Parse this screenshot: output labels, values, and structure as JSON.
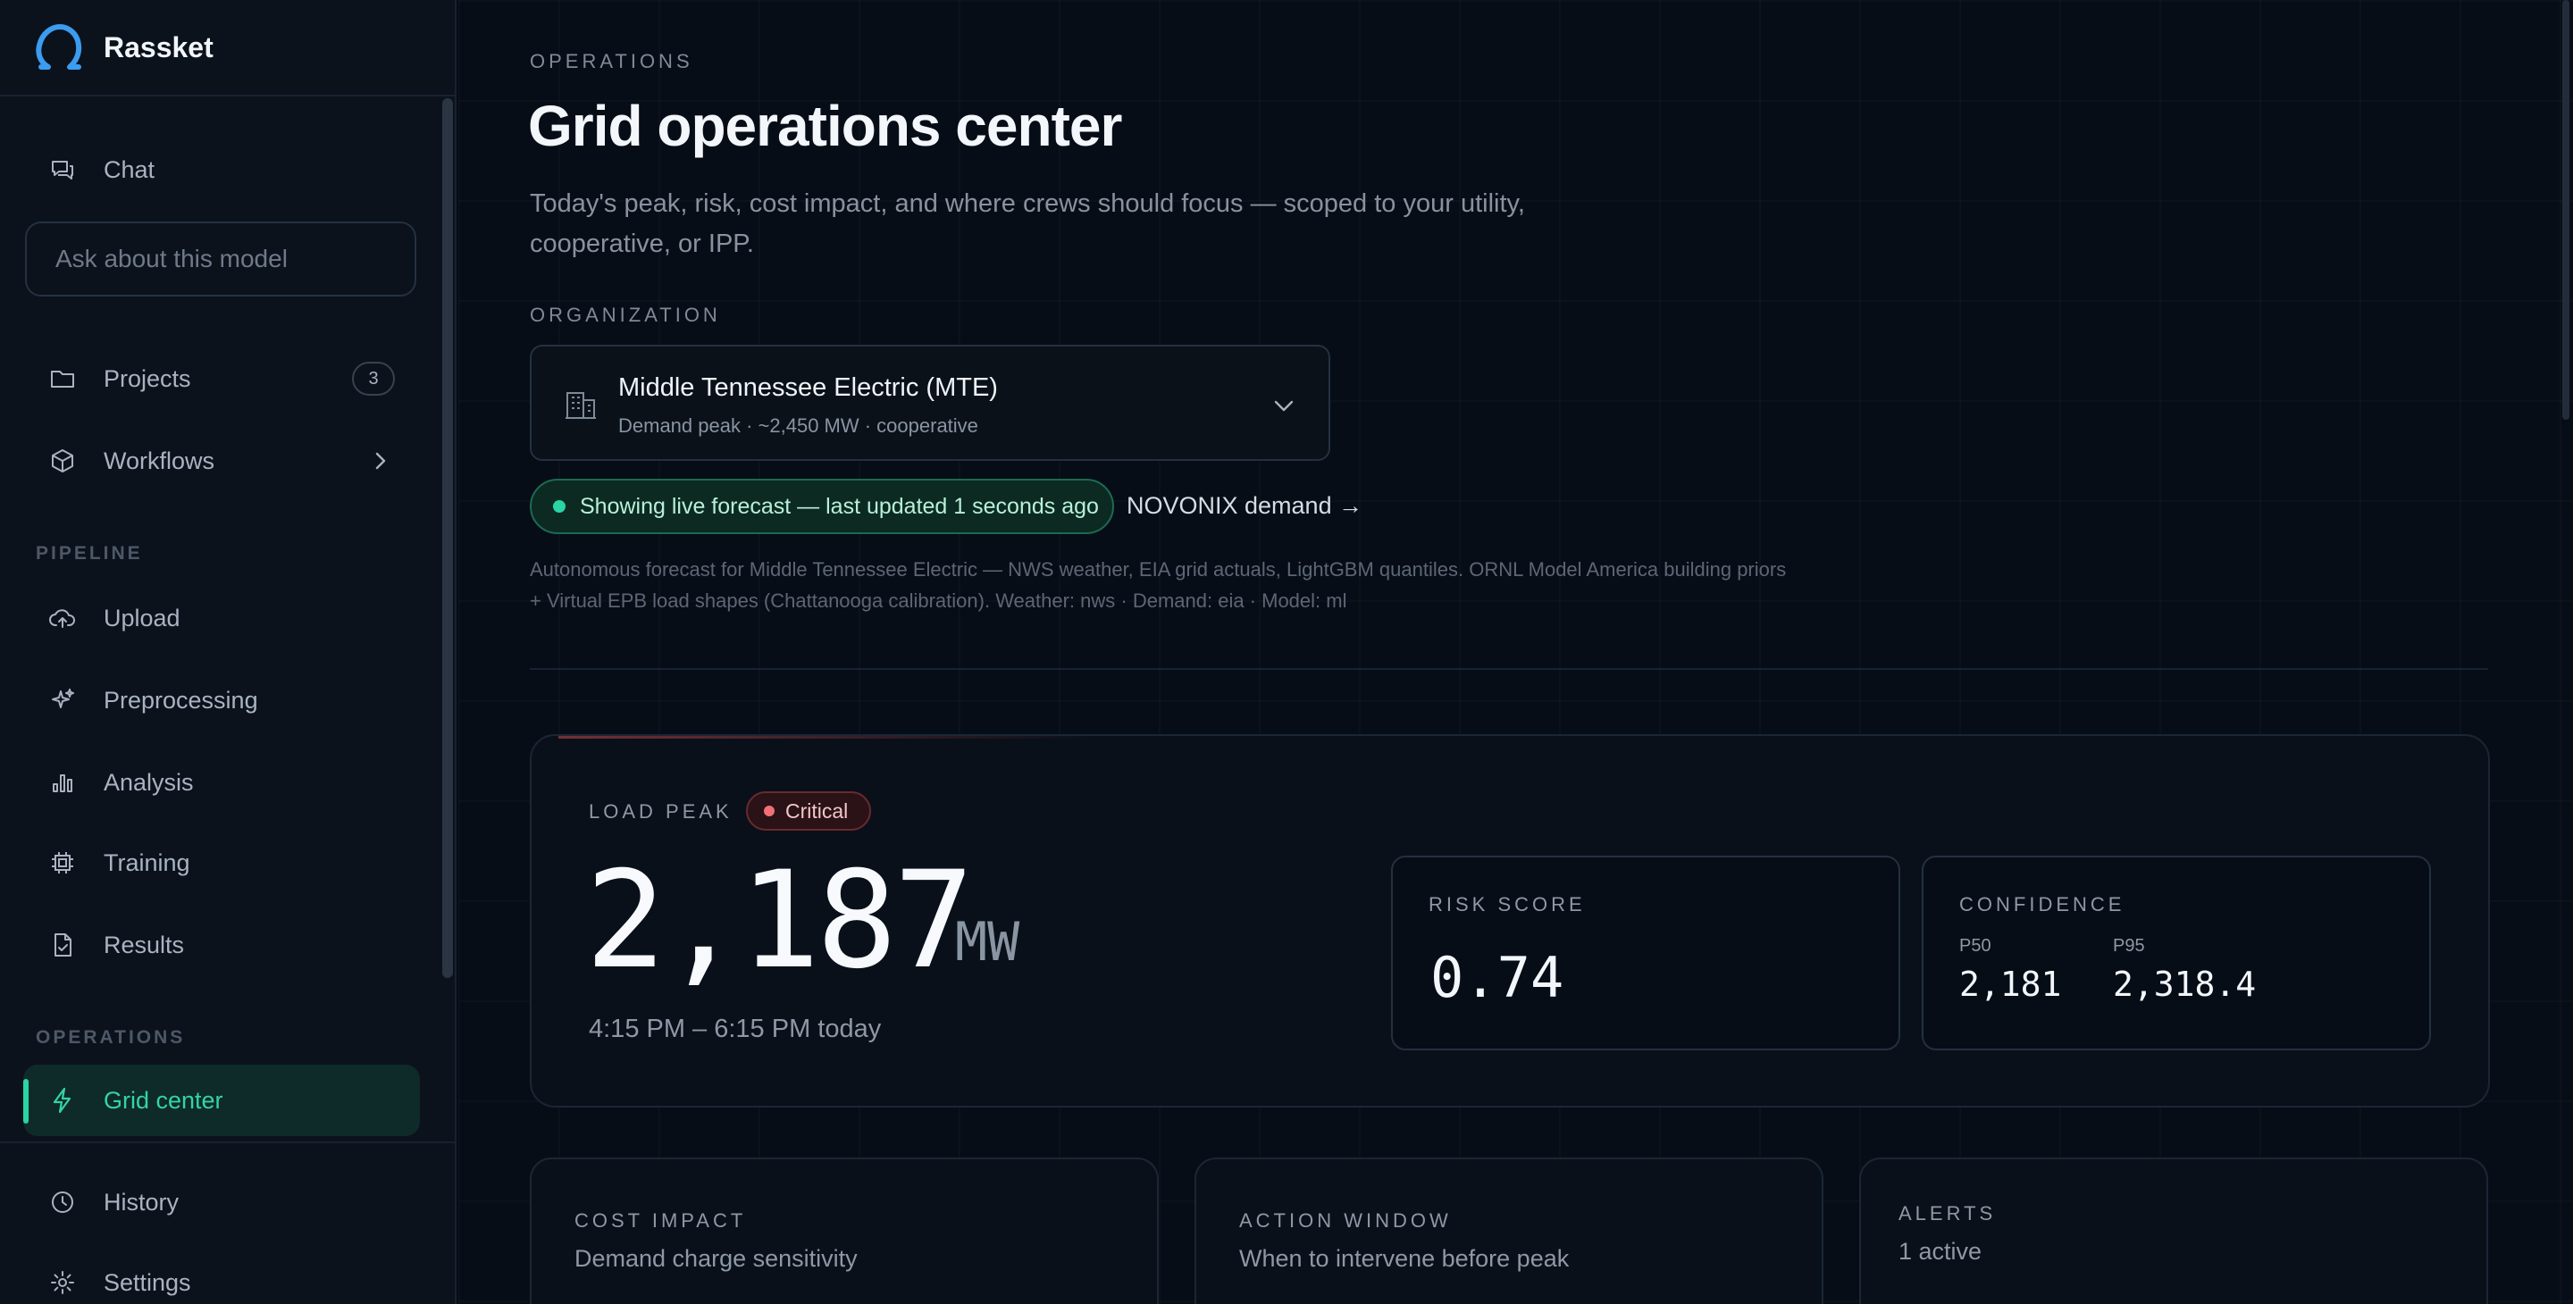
{
  "app": {
    "name": "Rassket"
  },
  "sidebar": {
    "chat_label": "Chat",
    "ask_placeholder": "Ask about this model",
    "projects_label": "Projects",
    "projects_count": "3",
    "workflows_label": "Workflows",
    "pipeline_section": "PIPELINE",
    "pipeline_items": [
      {
        "label": "Upload",
        "icon": "cloud-upload-icon"
      },
      {
        "label": "Preprocessing",
        "icon": "sparkles-icon"
      },
      {
        "label": "Analysis",
        "icon": "bar-chart-icon"
      },
      {
        "label": "Training",
        "icon": "cpu-icon"
      },
      {
        "label": "Results",
        "icon": "file-check-icon"
      }
    ],
    "operations_section": "OPERATIONS",
    "grid_center_label": "Grid center",
    "history_label": "History",
    "settings_label": "Settings"
  },
  "page": {
    "eyebrow": "OPERATIONS",
    "title": "Grid operations center",
    "subtitle": "Today's peak, risk, cost impact, and where crews should focus — scoped to your utility, cooperative, or IPP.",
    "org_section": "ORGANIZATION",
    "org_name": "Middle Tennessee Electric (MTE)",
    "org_meta": "Demand peak · ~2,450 MW · cooperative",
    "live_status": "Showing live forecast — last updated 1 seconds ago",
    "novonix_link": "NOVONIX demand →",
    "description": "Autonomous forecast for Middle Tennessee Electric — NWS weather, EIA grid actuals, LightGBM quantiles. ORNL Model America building priors + Virtual EPB load shapes (Chattanooga calibration). Weather: nws · Demand: eia · Model: ml"
  },
  "peak": {
    "label": "LOAD PEAK",
    "severity": "Critical",
    "value": "2,187",
    "unit": "MW",
    "window": "4:15 PM – 6:15 PM today",
    "risk_label": "RISK SCORE",
    "risk_value": "0.74",
    "confidence_label": "CONFIDENCE",
    "p50_label": "P50",
    "p50_value": "2,181",
    "p95_label": "P95",
    "p95_value": "2,318.4"
  },
  "cards": {
    "cost_label": "COST IMPACT",
    "cost_sub": "Demand charge sensitivity",
    "action_label": "ACTION WINDOW",
    "action_sub": "When to intervene before peak",
    "alerts_label": "ALERTS",
    "alerts_sub": "1 active"
  },
  "colors": {
    "accent": "#2ad4a4",
    "critical": "#f07078",
    "background": "#070d16"
  }
}
